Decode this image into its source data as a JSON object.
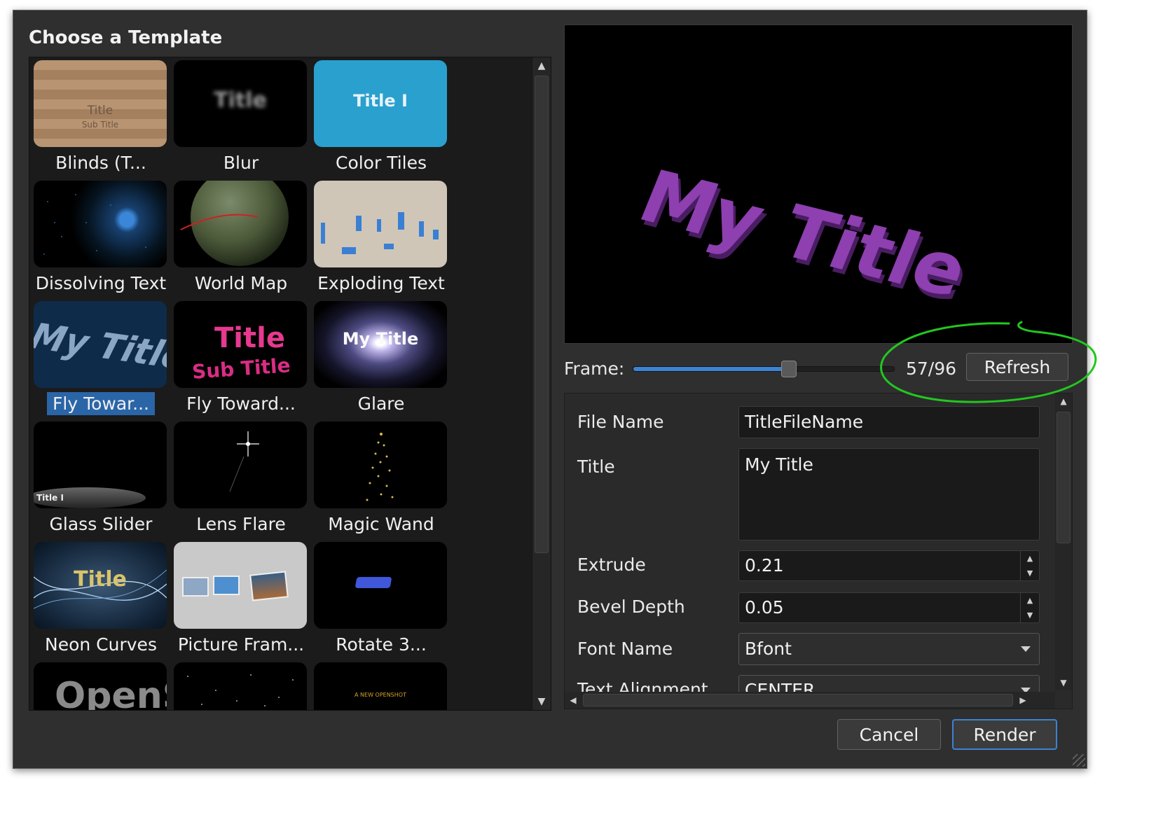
{
  "dialog": {
    "heading": "Choose a Template",
    "templates": [
      {
        "label": "Blinds (T...",
        "thumb_title": "Title",
        "thumb_subtitle": "Sub Title"
      },
      {
        "label": "Blur",
        "thumb_title": "Title"
      },
      {
        "label": "Color Tiles",
        "thumb_title": "Title I"
      },
      {
        "label": "Dissolving Text"
      },
      {
        "label": "World Map"
      },
      {
        "label": "Exploding Text"
      },
      {
        "label": "Fly Towar...",
        "thumb_title": "My Title",
        "selected": true
      },
      {
        "label": "Fly Toward...",
        "thumb_title": "Title",
        "thumb_subtitle": "Sub Title"
      },
      {
        "label": "Glare",
        "thumb_title": "My Title"
      },
      {
        "label": "Glass Slider",
        "thumb_title": "Title I"
      },
      {
        "label": "Lens Flare"
      },
      {
        "label": "Magic Wand"
      },
      {
        "label": "Neon Curves",
        "thumb_title": "Title"
      },
      {
        "label": "Picture Fram..."
      },
      {
        "label": "Rotate 3..."
      },
      {
        "label": "",
        "thumb_title": "OpenS"
      },
      {
        "label": ""
      },
      {
        "label": "",
        "thumb_title": "A NEW OPENSHOT"
      }
    ],
    "preview_text": "My Title",
    "frame": {
      "label": "Frame:",
      "current": 57,
      "total": 96,
      "count_text": "57/96",
      "refresh_label": "Refresh"
    },
    "properties": {
      "file_name_label": "File Name",
      "file_name_value": "TitleFileName",
      "title_label": "Title",
      "title_value": "My Title",
      "extrude_label": "Extrude",
      "extrude_value": "0.21",
      "bevel_label": "Bevel Depth",
      "bevel_value": "0.05",
      "font_label": "Font Name",
      "font_value": "Bfont",
      "align_label": "Text Alignment",
      "align_value": "CENTER"
    },
    "buttons": {
      "cancel": "Cancel",
      "render": "Render"
    }
  },
  "colors": {
    "accent": "#3d82d4",
    "selection": "#2a65a8",
    "title_purple": "#8e3fb0",
    "annotation": "#22c71f"
  }
}
